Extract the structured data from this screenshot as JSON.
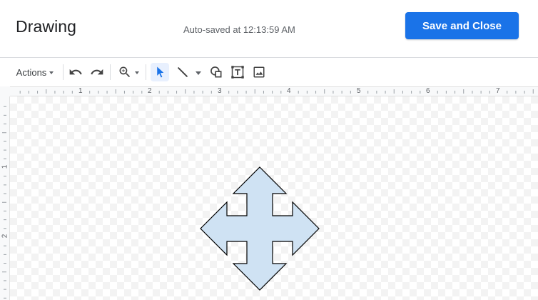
{
  "header": {
    "title": "Drawing",
    "autosave_text": "Auto-saved at 12:13:59 AM",
    "save_label": "Save and Close"
  },
  "toolbar": {
    "actions_label": "Actions",
    "icons": [
      "undo-icon",
      "redo-icon",
      "zoom-icon",
      "select-icon",
      "line-icon",
      "shape-icon",
      "text-box-icon",
      "image-icon"
    ]
  },
  "ruler": {
    "horizontal_labels": [
      "1",
      "2",
      "3",
      "4",
      "5",
      "6",
      "7"
    ],
    "vertical_labels": [
      "1",
      "2"
    ]
  },
  "canvas": {
    "shape_name": "four-way-arrow",
    "fill_color": "#cfe2f3",
    "stroke_color": "#000000"
  },
  "colors": {
    "accent": "#1a73e8",
    "selected_tool_bg": "#e8f0fe"
  }
}
